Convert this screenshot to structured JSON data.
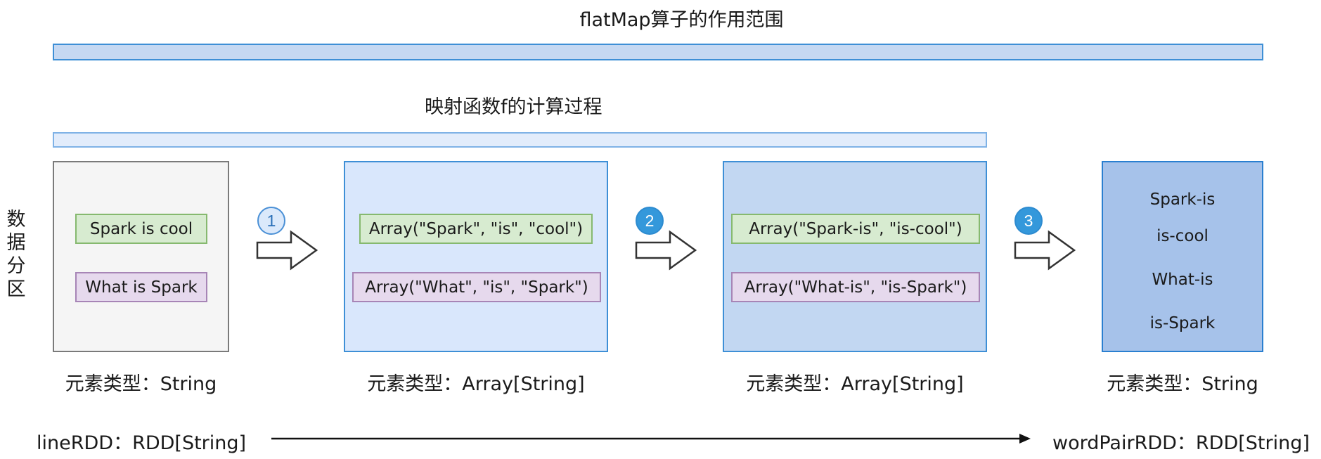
{
  "diagram": {
    "top_title": "flatMap算子的作用范围",
    "inner_title": "映射函数f的计算过程",
    "side_label": [
      "数",
      "据",
      "分",
      "区"
    ],
    "panels": [
      {
        "items": [
          "Spark is cool",
          "What is Spark"
        ],
        "type_label": "元素类型：String"
      },
      {
        "items": [
          "Array(\"Spark\", \"is\", \"cool\")",
          "Array(\"What\", \"is\", \"Spark\")"
        ],
        "type_label": "元素类型：Array[String]"
      },
      {
        "items": [
          "Array(\"Spark-is\", \"is-cool\")",
          "Array(\"What-is\", \"is-Spark\")"
        ],
        "type_label": "元素类型：Array[String]"
      },
      {
        "items": [
          "Spark-is",
          "is-cool",
          "What-is",
          "is-Spark"
        ],
        "type_label": "元素类型：String"
      }
    ],
    "steps": [
      "1",
      "2",
      "3"
    ],
    "source_rdd": "lineRDD：RDD[String]",
    "target_rdd": "wordPairRDD：RDD[String]",
    "colors": {
      "outer_bar": "#c5d8f2",
      "inner_bar": "#e2ecfb",
      "panel_1": "#f5f5f5",
      "panel_2": "#d9e7fc",
      "panel_3": "#c2d7f2",
      "panel_4": "#a6c2ea",
      "chip_green": "#d7ebd0",
      "chip_purple": "#e6d9ed",
      "step_accent": "#3498db"
    }
  }
}
